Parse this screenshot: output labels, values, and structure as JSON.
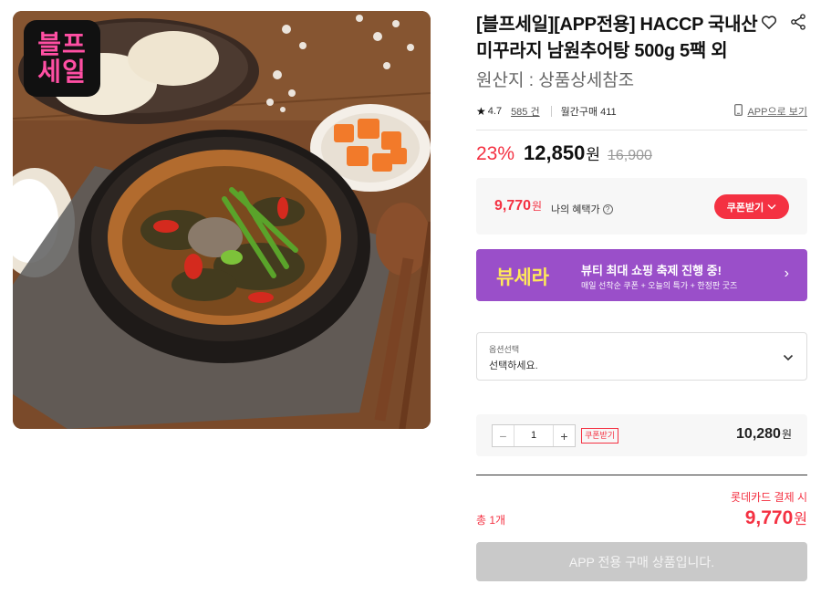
{
  "product": {
    "sale_logo_lines": [
      "블프",
      "세일"
    ],
    "title": "[블프세일][APP전용] HACCP 국내산 미꾸라지 남원추어탕 500g 5팩 외",
    "origin": "원산지 : 상품상세참조",
    "rating": "4.7",
    "review_count": "585 건",
    "monthly_purchase": "월간구매 411",
    "app_link": "APP으로 보기"
  },
  "pricing": {
    "discount": "23%",
    "price": "12,850",
    "unit": "원",
    "original_price": "16,900"
  },
  "benefit": {
    "price": "9,770",
    "unit": "원",
    "label": "나의 혜택가",
    "info": "?",
    "coupon_button": "쿠폰받기"
  },
  "banner": {
    "logo": "뷰세라",
    "title": "뷰티 최대 쇼핑 축제 진행 중!",
    "subtitle": "매일 선착순 쿠폰 + 오늘의 특가 + 한정판 굿즈",
    "arrow": "›"
  },
  "option": {
    "label": "옵션선택",
    "value": "선택하세요."
  },
  "quantity": {
    "minus": "−",
    "value": "1",
    "plus": "+",
    "coupon_tag": "쿠폰받기",
    "price": "10,280",
    "unit": "원"
  },
  "summary": {
    "card_note": "롯데카드 결제 시",
    "total_label": "총 1개",
    "total_price": "9,770",
    "unit": "원"
  },
  "buy_button": "APP 전용 구매 상품입니다.",
  "colors": {
    "accent": "#f43142",
    "banner": "#9a4fc9",
    "disabled": "#c9c9c9"
  },
  "icons": [
    "heart-icon",
    "share-icon",
    "star-icon",
    "mobile-icon",
    "info-icon",
    "chevron-down-icon",
    "chevron-right-icon"
  ]
}
